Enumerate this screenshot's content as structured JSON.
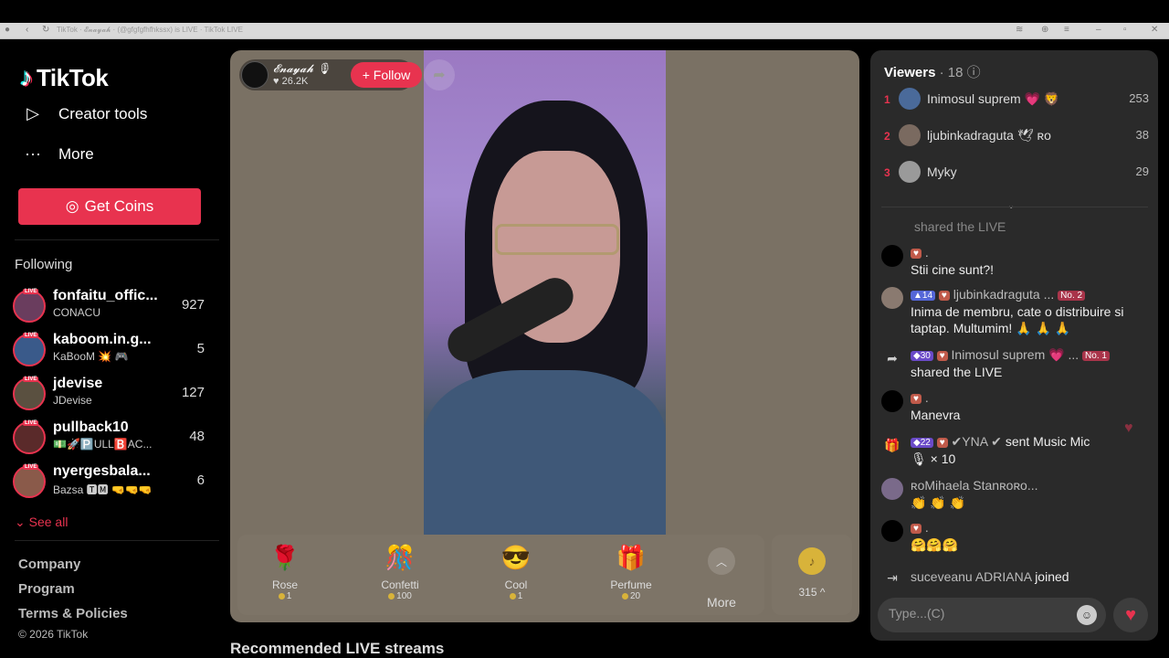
{
  "browser": {
    "tab_title": "TikTok · 𝓔𝓷𝓪𝔂𝓪𝓱 · (@gfgfgfhfhkssx) is LIVE · TikTok LIVE"
  },
  "sidebar": {
    "logo": "TikTok",
    "nav": [
      {
        "label": "Creator tools",
        "icon": "creator-tools-icon"
      },
      {
        "label": "More",
        "icon": "more-dots-icon"
      }
    ],
    "get_coins": "Get Coins",
    "following_title": "Following",
    "following": [
      {
        "name": "fonfaitu_offic...",
        "sub": "CONACU",
        "count": "927"
      },
      {
        "name": "kaboom.in.g...",
        "sub": "KaBooM 💥 🎮",
        "count": "5"
      },
      {
        "name": "jdevise",
        "sub": "JDevise",
        "count": "127"
      },
      {
        "name": "pullback10",
        "sub": "💵🚀🅿️ULL🅱️AC...",
        "count": "48"
      },
      {
        "name": "nyergesbala...",
        "sub": "Bazsa 🆃🅼 🤜🤜🤜",
        "count": "6"
      }
    ],
    "live_tag": "LIVE",
    "see_all": "See all",
    "footer": [
      "Company",
      "Program",
      "Terms & Policies"
    ],
    "copyright": "© 2026 TikTok"
  },
  "stream": {
    "host_name": "𝓔𝓷𝓪𝔂𝓪𝓱 🎙",
    "host_likes": "♥ 26.2K",
    "follow_label": "+ Follow",
    "gifts": [
      {
        "name": "Rose",
        "price": "1",
        "icon": "rose-icon",
        "glyph": "🌹"
      },
      {
        "name": "Confetti",
        "price": "100",
        "icon": "confetti-icon",
        "glyph": "🎊"
      },
      {
        "name": "Cool",
        "price": "1",
        "icon": "cool-icon",
        "glyph": "😎"
      },
      {
        "name": "Perfume",
        "price": "20",
        "icon": "perfume-icon",
        "glyph": "🎁"
      }
    ],
    "more_label": "More",
    "coin_balance": "315 ^",
    "recommended": "Recommended LIVE streams"
  },
  "chat": {
    "viewers_title": "Viewers",
    "viewers_count": "· 18",
    "viewers": [
      {
        "rank": "1",
        "name": "Inimosul suprem 💗 🦁",
        "score": "253"
      },
      {
        "rank": "2",
        "name": "ljubinkadraguta 🕊 ʀᴏ",
        "score": "38"
      },
      {
        "rank": "3",
        "name": "Myky",
        "score": "29"
      }
    ],
    "shared_top": "shared the LIVE",
    "messages": [
      {
        "head": ".",
        "text": "Stii cine sunt?!"
      },
      {
        "level": "14",
        "head": "ljubinkadraguta ...",
        "rank": "No. 2",
        "text": "Inima de membru, cate o distribuire si taptap. Multumim! 🙏 🙏 🙏"
      },
      {
        "level": "30",
        "head": "Inimosul suprem 💗 ...",
        "rank": "No. 1",
        "text": "shared the LIVE"
      },
      {
        "head": ".",
        "text": "Manevra"
      },
      {
        "level": "22",
        "head": "✔YNA ✔",
        "action": "sent Music Mic",
        "text": "🎙 × 10"
      },
      {
        "head": "ʀᴏMihaela Stanʀᴏʀᴏ...",
        "text": "👏 👏 👏"
      },
      {
        "head": ".",
        "text": "🤗🤗🤗"
      },
      {
        "head": "suceveanu ADRIANA",
        "action": "joined"
      }
    ],
    "input_placeholder": "Type...(C)"
  },
  "colors": {
    "accent": "#e8334f",
    "panel": "#2a2a2a",
    "stream_bg": "#7a7164"
  }
}
